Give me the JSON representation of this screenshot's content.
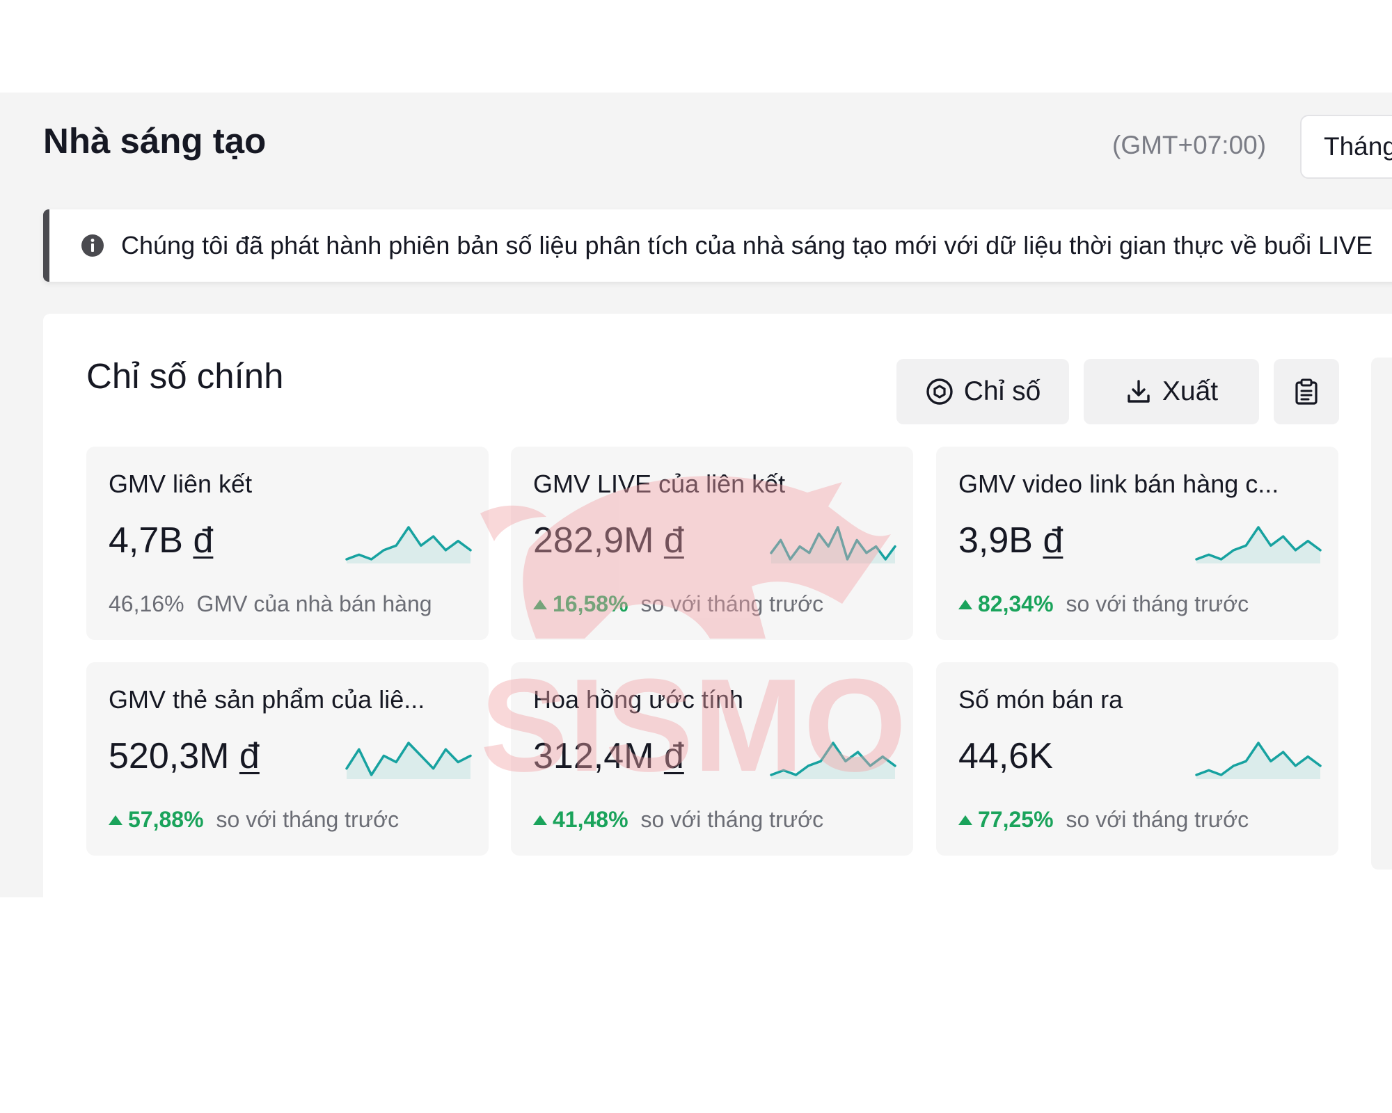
{
  "header": {
    "title": "Nhà sáng tạo",
    "timezone": "(GMT+07:00)",
    "period_label": "Tháng"
  },
  "notice": {
    "icon": "info-icon",
    "text": "Chúng tôi đã phát hành phiên bản số liệu phân tích của nhà sáng tạo mới với dữ liệu thời gian thực về buổi LIVE"
  },
  "key_metrics": {
    "title": "Chỉ số chính",
    "buttons": {
      "metrics_label": "Chỉ số",
      "export_label": "Xuất",
      "clipboard_icon": "clipboard-icon"
    },
    "metrics": [
      {
        "label": "GMV liên kết",
        "amount": "4,7B",
        "currency": "đ",
        "trend": "neutral",
        "pct": "46,16%",
        "note": "GMV của nhà bán hàng",
        "spark": [
          2,
          3,
          2,
          4,
          5,
          9,
          5,
          7,
          4,
          6,
          4
        ]
      },
      {
        "label": "GMV LIVE của liên kết",
        "amount": "282,9M",
        "currency": "đ",
        "trend": "up",
        "pct": "16,58%",
        "note": "so với tháng trước",
        "spark": [
          5,
          7,
          4,
          6,
          5,
          8,
          6,
          9,
          4,
          7,
          5,
          6,
          4,
          6
        ]
      },
      {
        "label": "GMV video link bán hàng c...",
        "amount": "3,9B",
        "currency": "đ",
        "trend": "up",
        "pct": "82,34%",
        "note": "so với tháng trước",
        "spark": [
          2,
          3,
          2,
          4,
          5,
          9,
          5,
          7,
          4,
          6,
          4
        ]
      },
      {
        "label": "GMV thẻ sản phẩm của liê...",
        "amount": "520,3M",
        "currency": "đ",
        "trend": "up",
        "pct": "57,88%",
        "note": "so với tháng trước",
        "spark": [
          5,
          8,
          4,
          7,
          6,
          9,
          7,
          5,
          8,
          6,
          7
        ]
      },
      {
        "label": "Hoa hồng ước tính",
        "amount": "312,4M",
        "currency": "đ",
        "trend": "up",
        "pct": "41,48%",
        "note": "so với tháng trước",
        "spark": [
          2,
          3,
          2,
          4,
          5,
          9,
          5,
          7,
          4,
          6,
          4
        ]
      },
      {
        "label": "Số món bán ra",
        "amount": "44,6K",
        "currency": "",
        "trend": "up",
        "pct": "77,25%",
        "note": "so với tháng trước",
        "spark": [
          2,
          3,
          2,
          4,
          5,
          9,
          5,
          7,
          4,
          6,
          4
        ]
      }
    ]
  },
  "watermark": {
    "text": "SISMO"
  },
  "colors": {
    "accent_line": "#17a2a0",
    "up": "#1aa35b",
    "watermark": "#f2a3a6"
  }
}
